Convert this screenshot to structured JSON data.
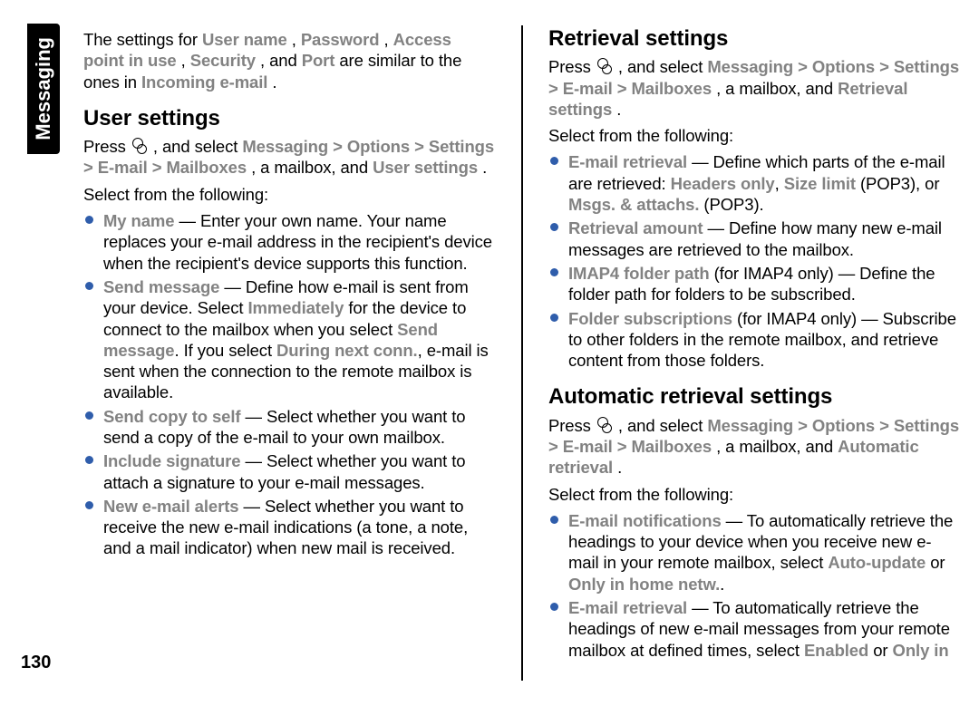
{
  "side_tab": "Messaging",
  "page_number": "130",
  "left": {
    "intro": {
      "pre": "The settings for ",
      "b1": "User name",
      "s1": ", ",
      "b2": "Password",
      "s2": ", ",
      "b3": "Access point in use",
      "s3": ", ",
      "b4": "Security",
      "s4": ", and ",
      "b5": "Port",
      "s5": " are similar to the ones in ",
      "b6": "Incoming e-mail",
      "s6": "."
    },
    "h_user": "User settings",
    "nav_user": {
      "press": "Press ",
      "after_icon": " , and select ",
      "m1": "Messaging",
      "gt1": " > ",
      "m2": "Options",
      "gt2": " > ",
      "m3": "Settings",
      "gt3": " > ",
      "m4": "E-mail",
      "gt4": " > ",
      "m5": "Mailboxes",
      "tail1": ", a mailbox, and ",
      "m6": "User settings",
      "tail2": "."
    },
    "select_from": "Select from the following:",
    "items": [
      {
        "lead": "My name",
        "dash": "  — ",
        "body": "Enter your own name. Your name replaces your e-mail address in the recipient's device when the recipient's device supports this function."
      },
      {
        "lead": "Send message",
        "dash": "  — ",
        "body_a": "Define how e-mail is sent from your device. Select ",
        "b_a": "Immediately",
        "body_b": " for the device to connect to the mailbox when you select ",
        "b_b": "Send message",
        "body_c": ". If you select ",
        "b_c": "During next conn.",
        "body_d": ", e-mail is sent when the connection to the remote mailbox is available."
      },
      {
        "lead": "Send copy to self",
        "dash": "  — ",
        "body": "Select whether you want to send a copy of the e-mail to your own mailbox."
      },
      {
        "lead": "Include signature",
        "dash": "  — ",
        "body": "Select whether you want to attach a signature to your e-mail messages."
      },
      {
        "lead": "New e-mail alerts",
        "dash": "  — ",
        "body": "Select whether you want to receive the new e-mail indications (a tone, a note, and a mail indicator) when new mail is received."
      }
    ]
  },
  "right": {
    "h_retr": "Retrieval settings",
    "nav_retr": {
      "press": "Press ",
      "after_icon": " , and select ",
      "m1": "Messaging",
      "gt1": " > ",
      "m2": "Options",
      "gt2": " > ",
      "m3": "Settings",
      "gt3": " > ",
      "m4": "E-mail",
      "gt4": " > ",
      "m5": "Mailboxes",
      "tail1": ", a mailbox, and ",
      "m6": "Retrieval settings",
      "tail2": "."
    },
    "select_from": "Select from the following:",
    "retr_items": [
      {
        "lead": "E-mail retrieval",
        "dash": "  — ",
        "body_a": "Define which parts of the e-mail are retrieved: ",
        "b_a": "Headers only",
        "body_b": ", ",
        "b_b": "Size limit",
        "body_c": " (POP3), or ",
        "b_c": "Msgs. & attachs.",
        "body_d": " (POP3)."
      },
      {
        "lead": "Retrieval amount",
        "dash": "  — ",
        "body": "Define how many new e-mail messages are retrieved to the mailbox."
      },
      {
        "lead": "IMAP4 folder path",
        "dash": " ",
        "body_a": "(for IMAP4 only)  — Define the folder path for folders to be subscribed."
      },
      {
        "lead": "Folder subscriptions",
        "dash": " ",
        "body_a": "(for IMAP4 only)  — Subscribe to other folders in the remote mailbox, and retrieve content from those folders."
      }
    ],
    "h_auto": "Automatic retrieval settings",
    "nav_auto": {
      "press": "Press ",
      "after_icon": " , and select ",
      "m1": "Messaging",
      "gt1": " > ",
      "m2": "Options",
      "gt2": " > ",
      "m3": "Settings",
      "gt3": " > ",
      "m4": "E-mail",
      "gt4": " > ",
      "m5": "Mailboxes",
      "tail1": ", a mailbox, and ",
      "m6": "Automatic retrieval",
      "tail2": "."
    },
    "select_from2": "Select from the following:",
    "auto_items": [
      {
        "lead": "E-mail notifications",
        "dash": "  — ",
        "body_a": "To automatically retrieve the headings to your device when you receive new e-mail in your remote mailbox, select ",
        "b_a": "Auto-update",
        "body_b": " or ",
        "b_b": "Only in home netw.",
        "body_c": "."
      },
      {
        "lead": "E-mail retrieval",
        "dash": "  — ",
        "body_a": "To automatically retrieve the headings of new e-mail messages from your remote mailbox at defined times, select ",
        "b_a": "Enabled",
        "body_b": " or ",
        "b_b": "Only in"
      }
    ]
  }
}
